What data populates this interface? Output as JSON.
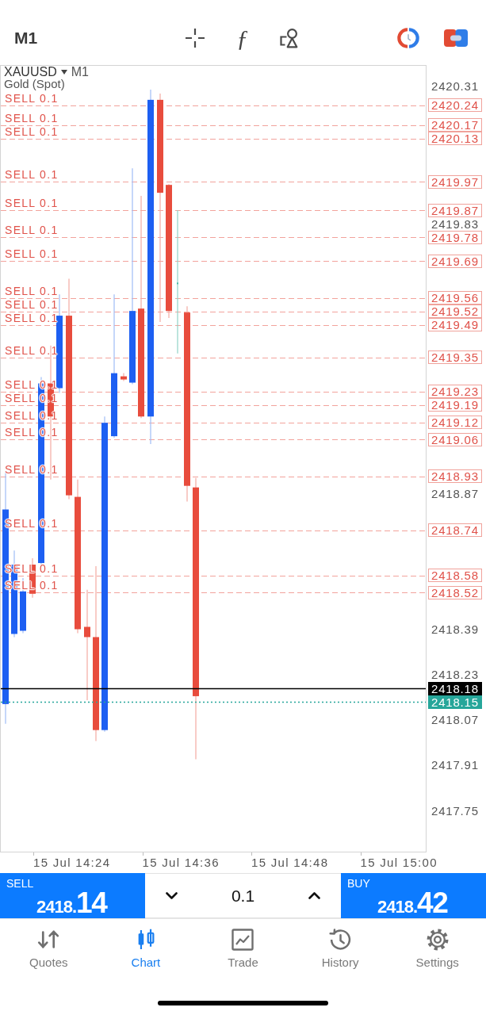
{
  "toolbar": {
    "timeframe": "M1",
    "indicator_glyph": "ƒ"
  },
  "chart": {
    "symbol": "XAUUSD",
    "timeframe": "M1",
    "description": "Gold (Spot)",
    "orders": [
      {
        "label": "SELL 0.1",
        "price": "2420.24"
      },
      {
        "label": "SELL 0.1",
        "price": "2420.17"
      },
      {
        "label": "SELL 0.1",
        "price": "2420.13"
      },
      {
        "label": "SELL 0.1",
        "price": "2419.97"
      },
      {
        "label": "SELL 0.1",
        "price": "2419.87"
      },
      {
        "label": "SELL 0.1",
        "price": "2419.78"
      },
      {
        "label": "SELL 0.1",
        "price": "2419.69"
      },
      {
        "label": "SELL 0.1",
        "price": "2419.56"
      },
      {
        "label": "SELL 0.1",
        "price": "2419.52"
      },
      {
        "label": "SELL 0.1",
        "price": "2419.49"
      },
      {
        "label": "SELL 0.1",
        "price": "2419.35"
      },
      {
        "label": "SELL 0.1",
        "price": "2419.23"
      },
      {
        "label": "SELL 0.1",
        "price": "2419.19"
      },
      {
        "label": "SELL 0.1",
        "price": "2419.12"
      },
      {
        "label": "SELL 0.1",
        "price": "2419.06"
      },
      {
        "label": "SELL 0.1",
        "price": "2418.93"
      },
      {
        "label": "SELL 0.1",
        "price": "2418.74"
      },
      {
        "label": "SELL 0.1",
        "price": "2418.58"
      },
      {
        "label": "SELL 0.1",
        "price": "2418.52"
      }
    ],
    "price_lines": [
      {
        "kind": "solid",
        "price": "2418.18"
      },
      {
        "kind": "dotted",
        "price": "2418.15"
      }
    ],
    "price_labels": [
      "2420.31",
      "2419.83",
      "2418.87",
      "2418.39",
      "2418.23",
      "2418.07",
      "2417.91",
      "2417.75"
    ],
    "time_labels": [
      "15 Jul 14:24",
      "15 Jul 14:36",
      "15 Jul 14:48",
      "15 Jul 15:00"
    ]
  },
  "trade_panel": {
    "sell": {
      "label": "SELL",
      "price": "2418.",
      "pips": "14"
    },
    "volume": "0.1",
    "buy": {
      "label": "BUY",
      "price": "2418.",
      "pips": "42"
    }
  },
  "tabs": [
    {
      "label": "Quotes",
      "selected": false
    },
    {
      "label": "Chart",
      "selected": true
    },
    {
      "label": "Trade",
      "selected": false
    },
    {
      "label": "History",
      "selected": false
    },
    {
      "label": "Settings",
      "selected": false
    }
  ]
}
